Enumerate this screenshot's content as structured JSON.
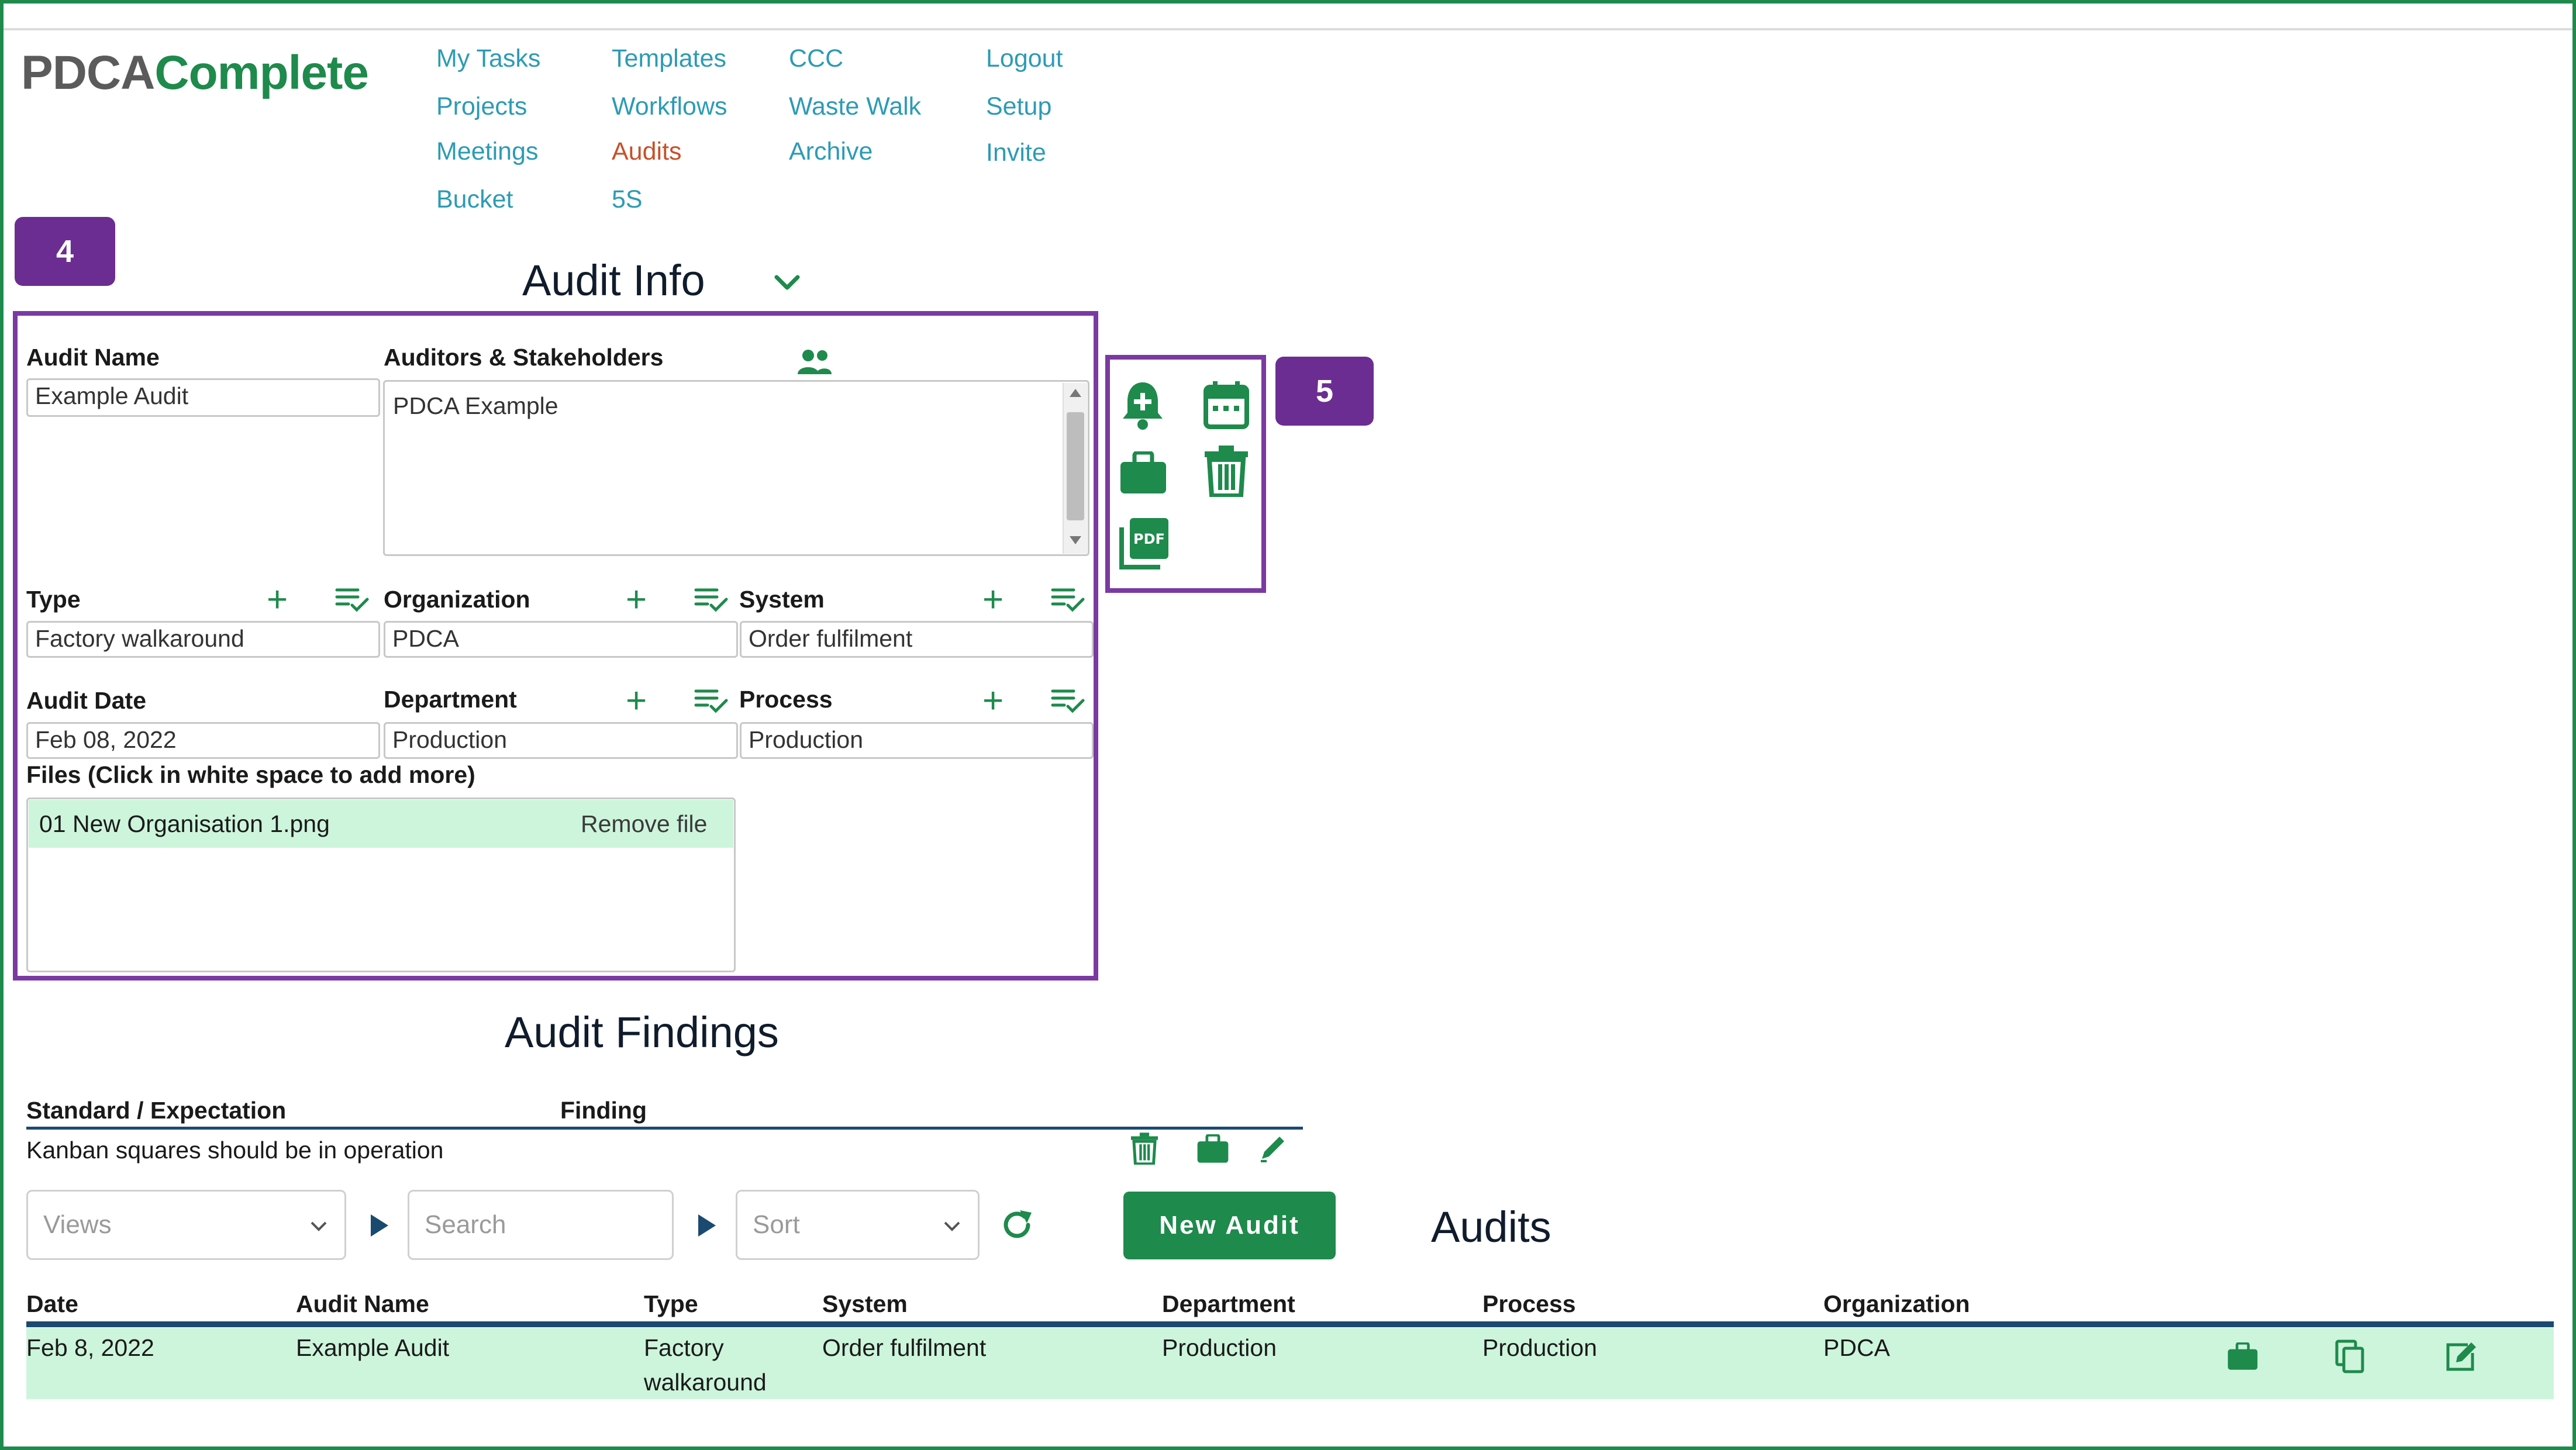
{
  "brand": {
    "logo_part1": "PDCA",
    "logo_part2": "Complete"
  },
  "nav": {
    "col1": [
      "My Tasks",
      "Projects",
      "Meetings",
      "Bucket"
    ],
    "col2": [
      "Templates",
      "Workflows",
      "Audits",
      "5S"
    ],
    "col3": [
      "CCC",
      "Waste Walk",
      "Archive"
    ],
    "col4": [
      "Logout",
      "Setup",
      "Invite"
    ],
    "active": "Audits"
  },
  "annotations": {
    "badge_4": "4",
    "badge_5": "5"
  },
  "audit_info": {
    "title": "Audit Info",
    "audit_name_label": "Audit Name",
    "audit_name_value": "Example Audit",
    "auditors_label": "Auditors & Stakeholders",
    "auditors_value": "PDCA Example",
    "type_label": "Type",
    "type_value": "Factory walkaround",
    "organization_label": "Organization",
    "organization_value": "PDCA",
    "system_label": "System",
    "system_value": "Order fulfilment",
    "audit_date_label": "Audit Date",
    "audit_date_value": "Feb 08, 2022",
    "department_label": "Department",
    "department_value": "Production",
    "process_label": "Process",
    "process_value": "Production",
    "files_label": "Files (Click in white space to add more)",
    "file_name": "01 New Organisation 1.png",
    "remove_file": "Remove file"
  },
  "action_icons": [
    "bell-plus-icon",
    "calendar-icon",
    "briefcase-icon",
    "trash-icon",
    "pdf-icon"
  ],
  "findings": {
    "title": "Audit Findings",
    "col_standard": "Standard / Expectation",
    "col_finding": "Finding",
    "row_standard": "Kanban squares should be in operation"
  },
  "toolbar": {
    "views_placeholder": "Views",
    "search_placeholder": "Search",
    "sort_placeholder": "Sort",
    "new_audit": "New Audit"
  },
  "audits": {
    "title": "Audits",
    "columns": [
      "Date",
      "Audit Name",
      "Type",
      "System",
      "Department",
      "Process",
      "Organization"
    ],
    "rows": [
      {
        "date": "Feb 8, 2022",
        "name": "Example Audit",
        "type_line1": "Factory",
        "type_line2": "walkaround",
        "system": "Order fulfilment",
        "department": "Production",
        "process": "Production",
        "organization": "PDCA"
      }
    ]
  },
  "colors": {
    "brand_green": "#1e8a4c",
    "nav_link": "#2d9bb4",
    "nav_active": "#c8502a",
    "annotation_purple": "#7a3aa2",
    "row_highlight": "#cdf5dc"
  }
}
